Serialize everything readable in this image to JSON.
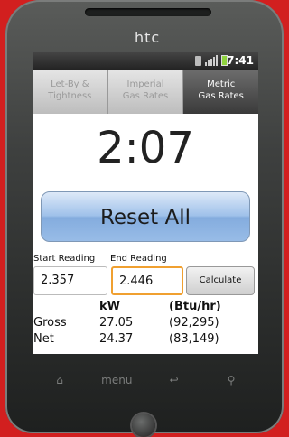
{
  "device": {
    "brand": "htc",
    "nav": {
      "home_icon": "⌂",
      "menu_label": "menu",
      "back_icon": "↩",
      "search_icon": "⚲"
    }
  },
  "status_bar": {
    "time": "7:41",
    "icons": [
      "sim-icon",
      "signal-icon",
      "battery-icon"
    ],
    "battery_color": "#8fd33f"
  },
  "tabs": [
    {
      "label": "Let-By &\nTightness",
      "active": false
    },
    {
      "label": "Imperial\nGas Rates",
      "active": false
    },
    {
      "label": "Metric\nGas Rates",
      "active": true
    }
  ],
  "timer": "2:07",
  "reset_button": "Reset All",
  "start_reading": {
    "label": "Start Reading",
    "value": "2.357"
  },
  "end_reading": {
    "label": "End Reading",
    "value": "2.446"
  },
  "calculate_button": "Calculate",
  "results": {
    "headers": [
      "",
      "kW",
      "(Btu/hr)"
    ],
    "rows": [
      {
        "label": "Gross",
        "kw": "27.05",
        "btu": "(92,295)"
      },
      {
        "label": "Net",
        "kw": "24.37",
        "btu": "(83,149)"
      }
    ]
  },
  "colors": {
    "background": "#d21f1f",
    "reset_button": "#9fc1ea",
    "focus_border": "#f0a030"
  }
}
